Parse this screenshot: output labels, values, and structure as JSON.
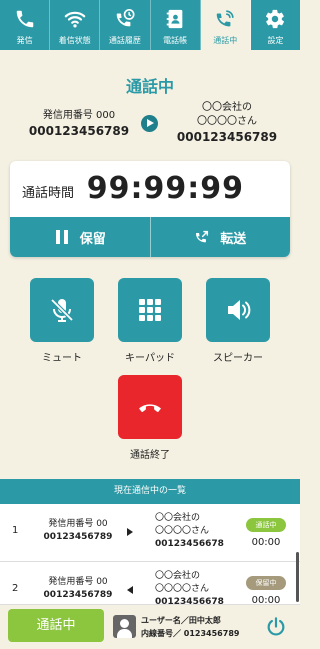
{
  "tabs": [
    {
      "label": "発信",
      "icon": "phone-icon",
      "active": false
    },
    {
      "label": "着信状態",
      "icon": "wifi-icon",
      "active": false
    },
    {
      "label": "通話履歴",
      "icon": "call-history-icon",
      "active": false
    },
    {
      "label": "電話帳",
      "icon": "phonebook-icon",
      "active": false
    },
    {
      "label": "通話中",
      "icon": "phone-ringing-icon",
      "active": true
    },
    {
      "label": "設定",
      "icon": "gear-icon",
      "active": false
    }
  ],
  "call": {
    "title": "通話中",
    "caller_label": "発信用番号 000",
    "caller_number": "000123456789",
    "callee_company": "〇〇会社の",
    "callee_name": "〇〇〇〇さん",
    "callee_number": "000123456789"
  },
  "timer": {
    "label": "通話時間",
    "value": "99:99:99",
    "hold_label": "保留",
    "transfer_label": "転送"
  },
  "actions": {
    "mute_label": "ミュート",
    "keypad_label": "キーパッド",
    "speaker_label": "スピーカー",
    "hangup_label": "通話終了"
  },
  "list": {
    "header": "現在通信中の一覧",
    "rows": [
      {
        "index": "1",
        "from_label": "発信用番号 00",
        "from_number": "00123456789",
        "direction": "outgoing",
        "to_company": "〇〇会社の",
        "to_name": "〇〇〇〇さん",
        "to_number": "00123456678",
        "status": "通話中",
        "status_color": "#8cc63f",
        "time": "00:00"
      },
      {
        "index": "2",
        "from_label": "発信用番号 00",
        "from_number": "00123456789",
        "direction": "incoming",
        "to_company": "〇〇会社の",
        "to_name": "〇〇〇〇さん",
        "to_number": "00123456678",
        "status": "保留中",
        "status_color": "#a59a7c",
        "time": "00:00"
      }
    ]
  },
  "bottom": {
    "status_label": "通話中",
    "user_line": "ユーザー名／田中太郎",
    "extension_line": "内線番号／ 0123456789"
  },
  "colors": {
    "primary": "#2b9aa6",
    "background": "#f4f1e3",
    "hangup": "#e8262b",
    "status_green": "#8cc63f"
  }
}
